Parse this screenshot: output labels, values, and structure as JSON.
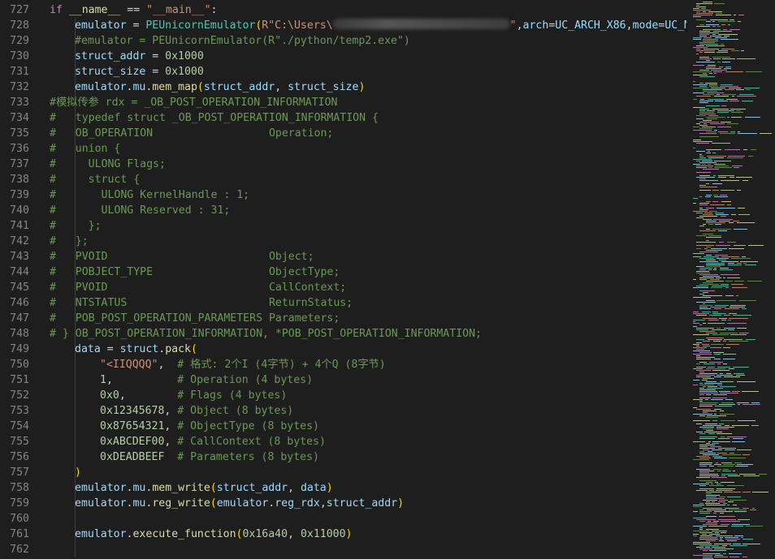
{
  "editor": {
    "lines": [
      {
        "n": "727",
        "indent": 0,
        "tokens": [
          [
            "kw",
            "if "
          ],
          [
            "dn",
            "__name__"
          ],
          [
            "op",
            " == "
          ],
          [
            "str",
            "\"__main__\""
          ],
          [
            "op",
            ":"
          ]
        ]
      },
      {
        "n": "728",
        "indent": 1,
        "tokens": [
          [
            "var",
            "emulator"
          ],
          [
            "op",
            " = "
          ],
          [
            "cls",
            "PEUnicornEmulator"
          ],
          [
            "p1",
            "("
          ],
          [
            "str",
            "R\"C:\\Users\\"
          ],
          [
            "blur",
            ""
          ],
          [
            "str",
            "\""
          ],
          [
            "pl",
            ","
          ],
          [
            "var",
            "arch"
          ],
          [
            "op",
            "="
          ],
          [
            "var",
            "UC_ARCH_X86"
          ],
          [
            "pl",
            ","
          ],
          [
            "var",
            "mode"
          ],
          [
            "op",
            "="
          ],
          [
            "var",
            "UC_MO"
          ]
        ]
      },
      {
        "n": "729",
        "indent": 1,
        "tokens": [
          [
            "cm",
            "#emulator = PEUnicornEmulator(R\"./python/temp2.exe\")"
          ]
        ]
      },
      {
        "n": "730",
        "indent": 1,
        "tokens": [
          [
            "var",
            "struct_addr"
          ],
          [
            "op",
            " = "
          ],
          [
            "num",
            "0x1000"
          ]
        ]
      },
      {
        "n": "731",
        "indent": 1,
        "tokens": [
          [
            "var",
            "struct_size"
          ],
          [
            "op",
            " = "
          ],
          [
            "num",
            "0x1000"
          ]
        ]
      },
      {
        "n": "732",
        "indent": 1,
        "tokens": [
          [
            "var",
            "emulator"
          ],
          [
            "pl",
            "."
          ],
          [
            "var",
            "mu"
          ],
          [
            "pl",
            "."
          ],
          [
            "fn",
            "mem_map"
          ],
          [
            "p1",
            "("
          ],
          [
            "var",
            "struct_addr"
          ],
          [
            "pl",
            ", "
          ],
          [
            "var",
            "struct_size"
          ],
          [
            "p1",
            ")"
          ]
        ]
      },
      {
        "n": "733",
        "indent": 0,
        "tokens": [
          [
            "cm",
            "#模拟传参 rdx = _OB_POST_OPERATION_INFORMATION"
          ]
        ]
      },
      {
        "n": "734",
        "indent": 0,
        "tokens": [
          [
            "cm",
            "#   typedef struct _OB_POST_OPERATION_INFORMATION {"
          ]
        ]
      },
      {
        "n": "735",
        "indent": 0,
        "tokens": [
          [
            "cm",
            "#   OB_OPERATION                  Operation;"
          ]
        ]
      },
      {
        "n": "736",
        "indent": 0,
        "tokens": [
          [
            "cm",
            "#   union {"
          ]
        ]
      },
      {
        "n": "737",
        "indent": 0,
        "tokens": [
          [
            "cm",
            "#     ULONG Flags;"
          ]
        ]
      },
      {
        "n": "738",
        "indent": 0,
        "tokens": [
          [
            "cm",
            "#     struct {"
          ]
        ]
      },
      {
        "n": "739",
        "indent": 0,
        "tokens": [
          [
            "cm",
            "#       ULONG KernelHandle : 1;"
          ]
        ]
      },
      {
        "n": "740",
        "indent": 0,
        "tokens": [
          [
            "cm",
            "#       ULONG Reserved : 31;"
          ]
        ]
      },
      {
        "n": "741",
        "indent": 0,
        "tokens": [
          [
            "cm",
            "#     };"
          ]
        ]
      },
      {
        "n": "742",
        "indent": 0,
        "tokens": [
          [
            "cm",
            "#   };"
          ]
        ]
      },
      {
        "n": "743",
        "indent": 0,
        "tokens": [
          [
            "cm",
            "#   PVOID                         Object;"
          ]
        ]
      },
      {
        "n": "744",
        "indent": 0,
        "tokens": [
          [
            "cm",
            "#   POBJECT_TYPE                  ObjectType;"
          ]
        ]
      },
      {
        "n": "745",
        "indent": 0,
        "tokens": [
          [
            "cm",
            "#   PVOID                         CallContext;"
          ]
        ]
      },
      {
        "n": "746",
        "indent": 0,
        "tokens": [
          [
            "cm",
            "#   NTSTATUS                      ReturnStatus;"
          ]
        ]
      },
      {
        "n": "747",
        "indent": 0,
        "tokens": [
          [
            "cm",
            "#   POB_POST_OPERATION_PARAMETERS Parameters;"
          ]
        ]
      },
      {
        "n": "748",
        "indent": 0,
        "tokens": [
          [
            "cm",
            "# } OB_POST_OPERATION_INFORMATION, *POB_POST_OPERATION_INFORMATION;"
          ]
        ]
      },
      {
        "n": "749",
        "indent": 1,
        "tokens": [
          [
            "var",
            "data"
          ],
          [
            "op",
            " = "
          ],
          [
            "var",
            "struct"
          ],
          [
            "pl",
            "."
          ],
          [
            "fn",
            "pack"
          ],
          [
            "p1",
            "("
          ]
        ]
      },
      {
        "n": "750",
        "indent": 2,
        "tokens": [
          [
            "str",
            "\"<IIQQQQ\""
          ],
          [
            "pl",
            ",  "
          ],
          [
            "cm",
            "# 格式: 2个I (4字节) + 4个Q (8字节)"
          ]
        ]
      },
      {
        "n": "751",
        "indent": 2,
        "tokens": [
          [
            "num",
            "1"
          ],
          [
            "pl",
            ",          "
          ],
          [
            "cm",
            "# Operation (4 bytes)"
          ]
        ]
      },
      {
        "n": "752",
        "indent": 2,
        "tokens": [
          [
            "num",
            "0x0"
          ],
          [
            "pl",
            ",        "
          ],
          [
            "cm",
            "# Flags (4 bytes)"
          ]
        ]
      },
      {
        "n": "753",
        "indent": 2,
        "tokens": [
          [
            "num",
            "0x12345678"
          ],
          [
            "pl",
            ", "
          ],
          [
            "cm",
            "# Object (8 bytes)"
          ]
        ]
      },
      {
        "n": "754",
        "indent": 2,
        "tokens": [
          [
            "num",
            "0x87654321"
          ],
          [
            "pl",
            ", "
          ],
          [
            "cm",
            "# ObjectType (8 bytes)"
          ]
        ]
      },
      {
        "n": "755",
        "indent": 2,
        "tokens": [
          [
            "num",
            "0xABCDEF00"
          ],
          [
            "pl",
            ", "
          ],
          [
            "cm",
            "# CallContext (8 bytes)"
          ]
        ]
      },
      {
        "n": "756",
        "indent": 2,
        "tokens": [
          [
            "num",
            "0xDEADBEEF"
          ],
          [
            "pl",
            "  "
          ],
          [
            "cm",
            "# Parameters (8 bytes)"
          ]
        ]
      },
      {
        "n": "757",
        "indent": 1,
        "tokens": [
          [
            "p1",
            ")"
          ]
        ]
      },
      {
        "n": "758",
        "indent": 1,
        "tokens": [
          [
            "var",
            "emulator"
          ],
          [
            "pl",
            "."
          ],
          [
            "var",
            "mu"
          ],
          [
            "pl",
            "."
          ],
          [
            "fn",
            "mem_write"
          ],
          [
            "p1",
            "("
          ],
          [
            "var",
            "struct_addr"
          ],
          [
            "pl",
            ", "
          ],
          [
            "var",
            "data"
          ],
          [
            "p1",
            ")"
          ]
        ]
      },
      {
        "n": "759",
        "indent": 1,
        "tokens": [
          [
            "var",
            "emulator"
          ],
          [
            "pl",
            "."
          ],
          [
            "var",
            "mu"
          ],
          [
            "pl",
            "."
          ],
          [
            "fn",
            "reg_write"
          ],
          [
            "p1",
            "("
          ],
          [
            "var",
            "emulator"
          ],
          [
            "pl",
            "."
          ],
          [
            "var",
            "reg_rdx"
          ],
          [
            "pl",
            ","
          ],
          [
            "var",
            "struct_addr"
          ],
          [
            "p1",
            ")"
          ]
        ]
      },
      {
        "n": "760",
        "indent": 0,
        "tokens": []
      },
      {
        "n": "761",
        "indent": 1,
        "tokens": [
          [
            "var",
            "emulator"
          ],
          [
            "pl",
            "."
          ],
          [
            "fn",
            "execute_function"
          ],
          [
            "p1",
            "("
          ],
          [
            "num",
            "0x16a40"
          ],
          [
            "pl",
            ", "
          ],
          [
            "num",
            "0x11000"
          ],
          [
            "p1",
            ")"
          ]
        ]
      },
      {
        "n": "762",
        "indent": 0,
        "tokens": []
      }
    ]
  },
  "colors": {
    "background": "#1e1e1e",
    "line_number": "#858585",
    "keyword": "#c586c0",
    "string": "#ce9178",
    "number": "#b5cea8",
    "comment": "#6a9955",
    "variable": "#9cdcfe",
    "class": "#4ec9b0",
    "function": "#dcdcaa"
  },
  "minimap": {
    "icon": "minimap-overview"
  }
}
